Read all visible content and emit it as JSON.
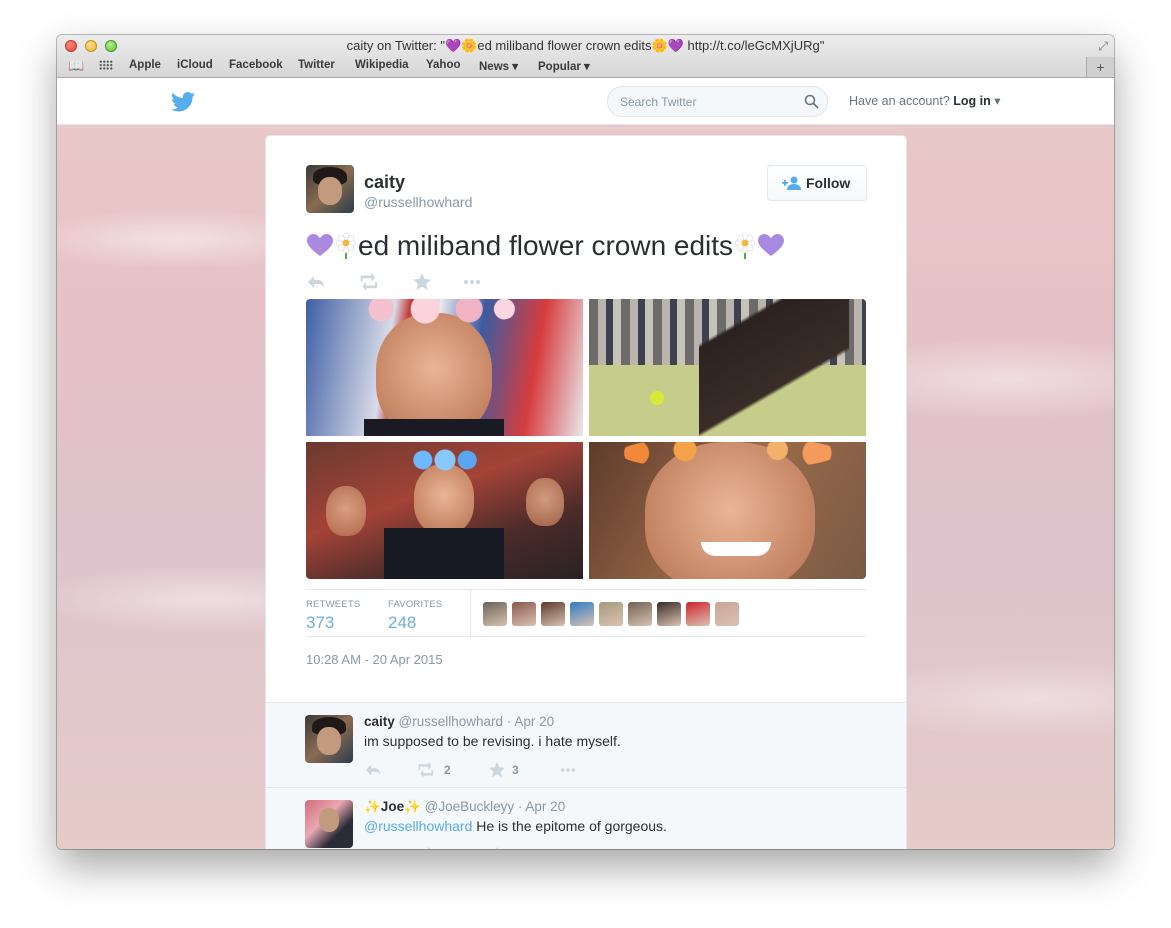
{
  "window": {
    "title_prefix": "caity on Twitter: \"",
    "title_heart": "💜",
    "title_flower": "🌼",
    "title_middle": "ed miliband flower crown edits",
    "title_suffix": " http://t.co/leGcMXjURg\""
  },
  "bookmarks": [
    "Apple",
    "iCloud",
    "Facebook",
    "Twitter",
    "Wikipedia",
    "Yahoo",
    "News ▾",
    "Popular ▾"
  ],
  "newtab_label": "+",
  "nav": {
    "search_placeholder": "Search Twitter",
    "account_prompt": "Have an account?",
    "login_label": "Log in",
    "login_caret": "▾"
  },
  "tweet": {
    "name": "caity",
    "handle": "@russellhowhard",
    "follow_label": "Follow",
    "text": "ed miliband flower crown edits",
    "retweets_label": "RETWEETS",
    "retweets": "373",
    "favorites_label": "FAVORITES",
    "favorites": "248",
    "timestamp": "10:28 AM - 20 Apr 2015",
    "favoriter_colors": [
      "#6b6357",
      "#8a5a4d",
      "#5b3a2c",
      "#2e7cc4",
      "#a79a7e",
      "#6f6252",
      "#3a2a24",
      "#d0232e",
      "#c9a59a"
    ]
  },
  "replies": [
    {
      "name": "caity",
      "handle": "@russellhowhard",
      "date": "· Apr 20",
      "mention": "",
      "text": "im supposed to be revising. i hate myself.",
      "retweets": "2",
      "favorites": "3"
    },
    {
      "name": "✨Joe✨",
      "handle": "@JoeBuckleyy",
      "date": "· Apr 20",
      "mention": "@russellhowhard",
      "text": " He is the epitome of gorgeous.",
      "retweets": "",
      "favorites": ""
    }
  ],
  "colors": {
    "twitter_blue": "#55acee",
    "stat_blue": "#6faed8",
    "text_dark": "#292f33",
    "text_muted": "#8899a6",
    "heart_purple": "#a062d6"
  },
  "icons": {
    "logo": "twitter-bird-icon",
    "search": "search-icon",
    "follow": "add-user-icon",
    "reply": "reply-icon",
    "retweet": "retweet-icon",
    "favorite": "star-icon",
    "more": "more-icon"
  }
}
